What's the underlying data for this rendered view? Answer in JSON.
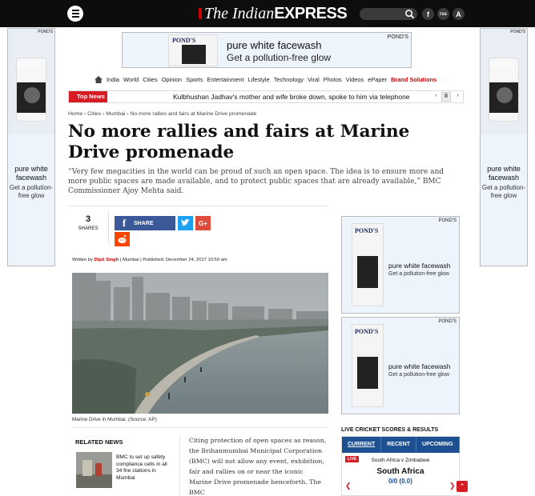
{
  "header": {
    "logo_the": "The Indian",
    "logo_express": "EXPRESS",
    "menu_icon": "hamburger-icon",
    "search_icon": "search-icon",
    "social": [
      "f",
      "rss",
      "A"
    ]
  },
  "ads": {
    "brand": "POND'S",
    "side_line1": "pure white facewash",
    "side_line2": "Get a pollution-free glow",
    "top_line1": "pure white facewash",
    "top_line2": "Get a pollution-free glow",
    "powered_by": "POND'S",
    "right_line1": "pure white facewash",
    "right_line2": "Get a pollution-free glow"
  },
  "nav": {
    "items": [
      "India",
      "World",
      "Cities",
      "Opinion",
      "Sports",
      "Entertainment",
      "Lifestyle",
      "Technology",
      "Viral",
      "Photos",
      "Videos",
      "ePaper"
    ],
    "brand_solutions": "Brand Solutions"
  },
  "top_news": {
    "label": "Top News",
    "headline": "Kulbhushan Jadhav's mother and wife broke down, spoke to him via telephone"
  },
  "breadcrumb": "Home › Cities › Mumbai › No more rallies and fairs at Marine Drive promenade",
  "article": {
    "headline": "No more rallies and fairs at Marine Drive promenade",
    "standfirst": "“Very few megacities in the world can be proud of such an open space.  The idea is to ensure more and more public spaces are made available, and to protect public spaces that are already available,” BMC Commissioner Ajoy Mehta said.",
    "shares_count": "3",
    "shares_label": "SHARES",
    "share_fb": "SHARE",
    "share_gp": "G+",
    "byline_prefix": "Written by",
    "author": "Dipti Singh",
    "byline_rest": " | Mumbai | Published: December 24, 2017 10:59 am",
    "caption": "Marine Drive in Mumbai. (Source: AP)",
    "body": "Citing protection of open spaces as reason, the Brihanmumbai Municipal Corporation (BMC) will not allow any event, exhibition, fair and rallies on or near the iconic Marine Drive promenade henceforth. The BMC"
  },
  "related": {
    "title": "RELATED NEWS",
    "item1": "BMC to set up safety compliance cells in all 34 fire stations in Mumbai"
  },
  "cricket": {
    "title": "LIVE CRICKET SCORES & RESULTS",
    "tabs": [
      "CURRENT",
      "RECENT",
      "UPCOMING"
    ],
    "live": "LIVE",
    "match": "South Africa v Zimbabwe",
    "team": "South Africa",
    "score": "0/0 (0.0)"
  }
}
